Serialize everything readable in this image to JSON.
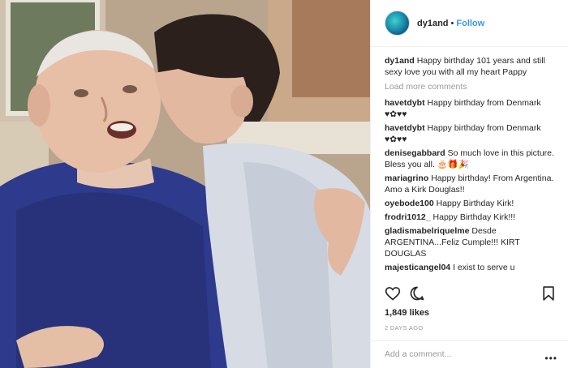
{
  "post": {
    "username": "dy1and",
    "separator": "•",
    "follow_label": "Follow",
    "avatar_icon": "avatar-image",
    "caption_user": "dy1and",
    "caption_text": "Happy birthday 101 years and still sexy love you with all my heart Pappy",
    "load_more_label": "Load more comments",
    "likes": "1,849 likes",
    "date": "2 DAYS AGO",
    "add_comment_placeholder": "Add a comment...",
    "more_options": "•••"
  },
  "comments": [
    {
      "user": "havetdybt",
      "text": "Happy birthday from Denmark ♥✿♥♥"
    },
    {
      "user": "havetdybt",
      "text": "Happy birthday from Denmark ♥✿♥♥"
    },
    {
      "user": "denisegabbard",
      "text": "So much love in this picture. Bless you all. 🎂🎁🎉"
    },
    {
      "user": "mariagrino",
      "text": "Happy birthday! From Argentina. Amo a Kirk Douglas!!"
    },
    {
      "user": "oyebode100",
      "text": "Happy Birthday Kirk!"
    },
    {
      "user": "frodri1012_",
      "text": "Happy Birthday Kirk!!!"
    },
    {
      "user": "gladismabelriquelme",
      "text": "Desde ARGENTINA...Feliz Cumple!!! KIRT DOUGLAS"
    },
    {
      "user": "majesticangel04",
      "text": "I exist to serve u"
    }
  ],
  "icons": {
    "like": "heart-icon",
    "comment": "comment-icon",
    "save": "bookmark-icon"
  },
  "colors": {
    "link_blue": "#3897f0",
    "text": "#262626",
    "muted": "#999999",
    "border": "#efefef"
  }
}
